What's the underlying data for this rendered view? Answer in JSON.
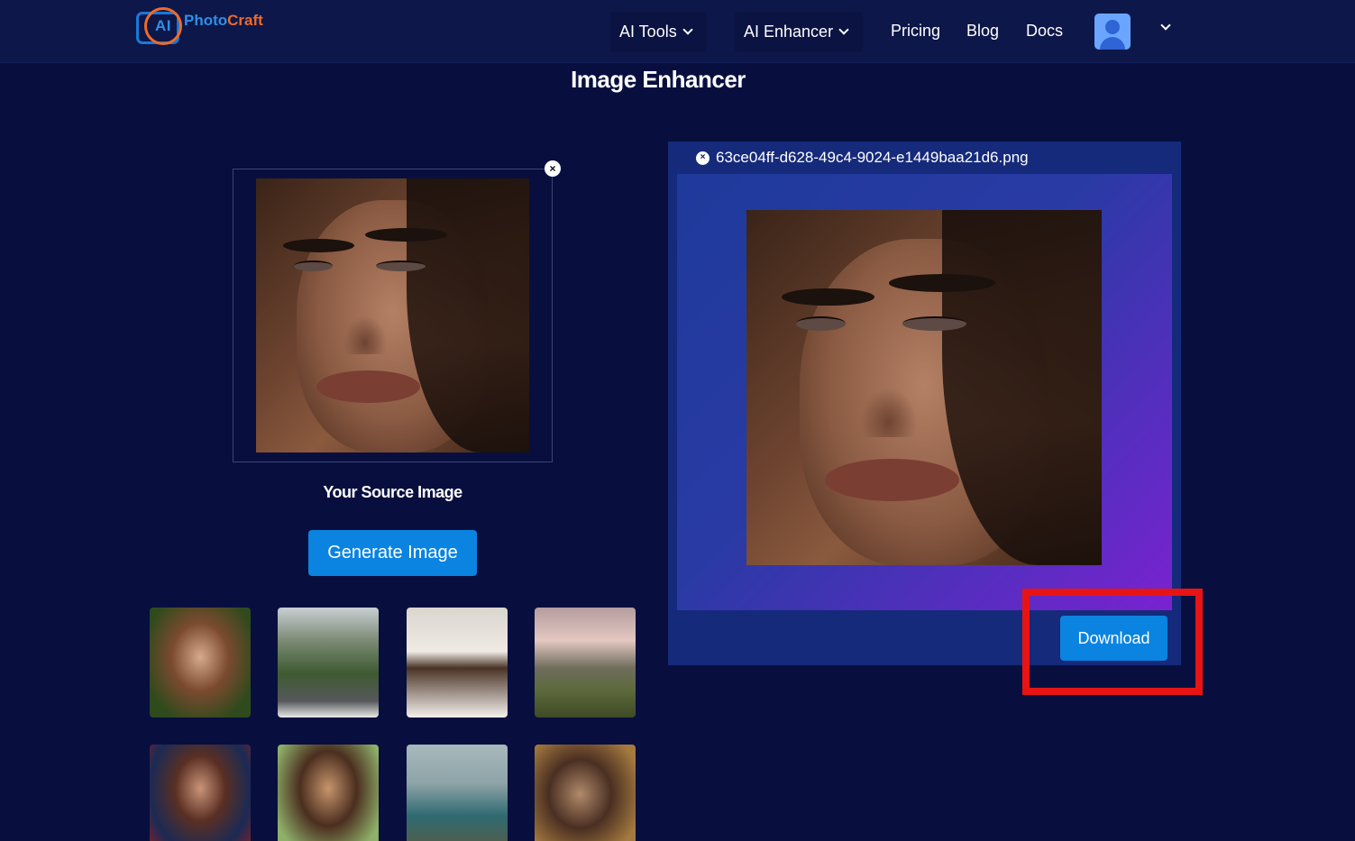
{
  "header": {
    "logo_ai": "AI",
    "logo_photo": "Photo",
    "logo_craft": "Craft",
    "nav": {
      "ai_tools": "AI Tools",
      "ai_enhancer": "AI Enhancer",
      "pricing": "Pricing",
      "blog": "Blog",
      "docs": "Docs"
    }
  },
  "page": {
    "title": "Image Enhancer"
  },
  "source": {
    "close_glyph": "×",
    "label": "Your Source Image",
    "generate_label": "Generate Image"
  },
  "result": {
    "filename": "63ce04ff-d628-49c4-9024-e1449baa21d6.png",
    "close_glyph": "×",
    "download_label": "Download"
  },
  "colors": {
    "background": "#080f3f",
    "header": "#0d1749",
    "button": "#0a84e0",
    "result_panel": "#152a7a",
    "highlight": "#e81414"
  }
}
